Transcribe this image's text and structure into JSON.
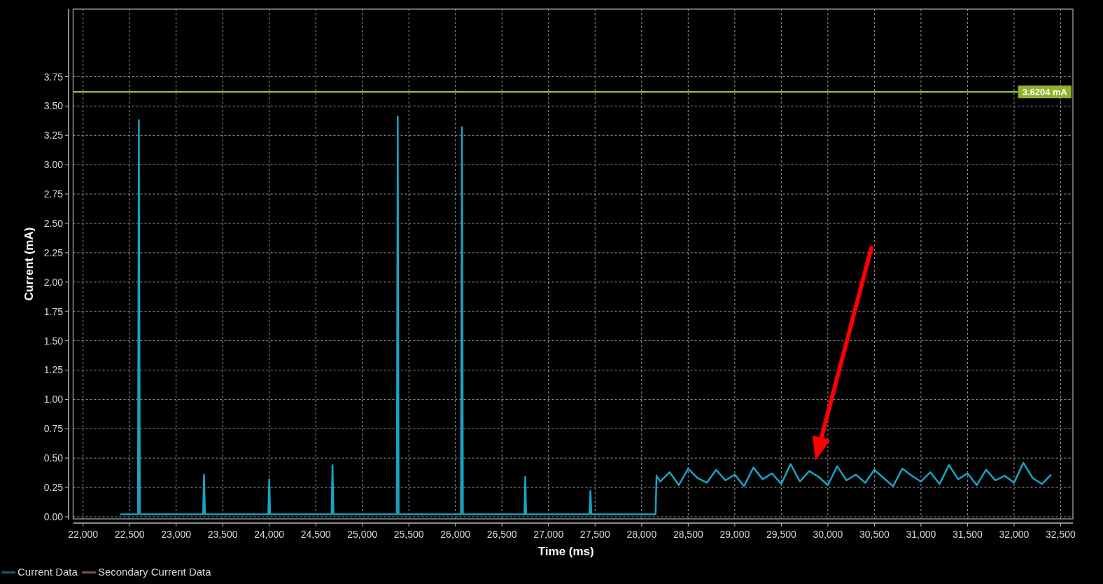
{
  "chart_data": {
    "type": "line",
    "xlabel": "Time (ms)",
    "ylabel": "Current (mA)",
    "x": [
      22400,
      22590,
      22600,
      22610,
      23290,
      23300,
      23310,
      23990,
      24000,
      24010,
      24670,
      24680,
      24690,
      25370,
      25380,
      25390,
      26060,
      26070,
      26080,
      26740,
      26750,
      26760,
      27440,
      27450,
      27460,
      28150,
      28160,
      28200,
      28300,
      28400,
      28500,
      28600,
      28700,
      28800,
      28900,
      29000,
      29100,
      29200,
      29300,
      29400,
      29500,
      29600,
      29700,
      29800,
      29900,
      30000,
      30100,
      30200,
      30300,
      30400,
      30500,
      30600,
      30700,
      30800,
      30900,
      31000,
      31100,
      31200,
      31300,
      31400,
      31500,
      31600,
      31700,
      31800,
      31900,
      32000,
      32100,
      32200,
      32300,
      32400
    ],
    "series": [
      {
        "name": "Current Data",
        "color": "#19a3c4",
        "values": [
          0.02,
          0.02,
          3.38,
          0.02,
          0.02,
          0.36,
          0.02,
          0.02,
          0.32,
          0.02,
          0.02,
          0.44,
          0.02,
          0.02,
          3.41,
          0.02,
          0.02,
          3.32,
          0.02,
          0.02,
          0.34,
          0.02,
          0.02,
          0.22,
          0.02,
          0.02,
          0.35,
          0.3,
          0.38,
          0.27,
          0.41,
          0.33,
          0.29,
          0.4,
          0.31,
          0.36,
          0.26,
          0.42,
          0.32,
          0.37,
          0.28,
          0.45,
          0.3,
          0.39,
          0.34,
          0.27,
          0.43,
          0.31,
          0.36,
          0.29,
          0.4,
          0.33,
          0.26,
          0.41,
          0.35,
          0.3,
          0.38,
          0.28,
          0.44,
          0.32,
          0.37,
          0.27,
          0.4,
          0.31,
          0.35,
          0.29,
          0.46,
          0.33,
          0.28,
          0.36
        ]
      }
    ],
    "xlim": [
      21894,
      32632
    ],
    "ylim": [
      -0.018,
      4.326
    ],
    "xticks": [
      {
        "value": 22000,
        "label": "22,000"
      },
      {
        "value": 22500,
        "label": "22,500"
      },
      {
        "value": 23000,
        "label": "23,000"
      },
      {
        "value": 23500,
        "label": "23,500"
      },
      {
        "value": 24000,
        "label": "24,000"
      },
      {
        "value": 24500,
        "label": "24,500"
      },
      {
        "value": 25000,
        "label": "25,000"
      },
      {
        "value": 25500,
        "label": "25,500"
      },
      {
        "value": 26000,
        "label": "26,000"
      },
      {
        "value": 26500,
        "label": "26,500"
      },
      {
        "value": 27000,
        "label": "27,000"
      },
      {
        "value": 27500,
        "label": "27,500"
      },
      {
        "value": 28000,
        "label": "28,000"
      },
      {
        "value": 28500,
        "label": "28,500"
      },
      {
        "value": 29000,
        "label": "29,000"
      },
      {
        "value": 29500,
        "label": "29,500"
      },
      {
        "value": 30000,
        "label": "30,000"
      },
      {
        "value": 30500,
        "label": "30,500"
      },
      {
        "value": 31000,
        "label": "31,000"
      },
      {
        "value": 31500,
        "label": "31,500"
      },
      {
        "value": 32000,
        "label": "32,000"
      },
      {
        "value": 32500,
        "label": "32,500"
      }
    ],
    "yticks": [
      {
        "value": 0,
        "label": "0.00"
      },
      {
        "value": 0.25,
        "label": "0.25"
      },
      {
        "value": 0.5,
        "label": "0.50"
      },
      {
        "value": 0.75,
        "label": "0.75"
      },
      {
        "value": 1,
        "label": "1.00"
      },
      {
        "value": 1.25,
        "label": "1.25"
      },
      {
        "value": 1.5,
        "label": "1.50"
      },
      {
        "value": 1.75,
        "label": "1.75"
      },
      {
        "value": 2,
        "label": "2.00"
      },
      {
        "value": 2.25,
        "label": "2.25"
      },
      {
        "value": 2.5,
        "label": "2.50"
      },
      {
        "value": 2.75,
        "label": "2.75"
      },
      {
        "value": 3,
        "label": "3.00"
      },
      {
        "value": 3.25,
        "label": "3.25"
      },
      {
        "value": 3.5,
        "label": "3.50"
      },
      {
        "value": 3.75,
        "label": "3.75"
      }
    ],
    "grid": true,
    "ref_lines": [
      {
        "axis": "y",
        "value": 3.6204,
        "label": "3.6204 mA",
        "color": "#8fb32a"
      }
    ]
  },
  "arrow_overlay": {
    "color": "#ff0000"
  },
  "legend": [
    {
      "label": "Secondary Current Data",
      "color": "#8a4a6a"
    }
  ]
}
